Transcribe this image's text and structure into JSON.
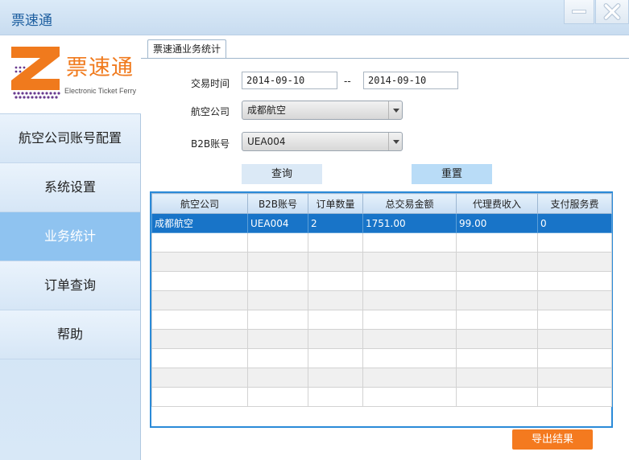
{
  "window": {
    "title": "票速通",
    "minimize_icon": "minimize-icon",
    "close_icon": "close-icon"
  },
  "logo": {
    "name": "票速通",
    "subtitle": "Electronic Ticket Ferry",
    "colors": {
      "orange": "#f07a1d",
      "purple": "#6a3b8f"
    }
  },
  "sidebar": {
    "items": [
      {
        "label": "航空公司账号配置",
        "active": false
      },
      {
        "label": "系统设置",
        "active": false
      },
      {
        "label": "业务统计",
        "active": true
      },
      {
        "label": "订单查询",
        "active": false
      },
      {
        "label": "帮助",
        "active": false
      }
    ]
  },
  "tab": {
    "label": "票速通业务统计"
  },
  "form": {
    "date_label": "交易时间",
    "date_from": "2014-09-10",
    "date_sep": "--",
    "date_to": "2014-09-10",
    "airline_label": "航空公司",
    "airline_value": "成都航空",
    "b2b_label": "B2B账号",
    "b2b_value": "UEA004",
    "query_button": "查询",
    "reset_button": "重置"
  },
  "table": {
    "columns": [
      "航空公司",
      "B2B账号",
      "订单数量",
      "总交易金额",
      "代理费收入",
      "支付服务费"
    ],
    "rows": [
      [
        "成都航空",
        "UEA004",
        "2",
        "1751.00",
        "99.00",
        "0"
      ]
    ],
    "selected_row": 0,
    "selected_color": "#1874c8"
  },
  "export_button": "导出结果"
}
